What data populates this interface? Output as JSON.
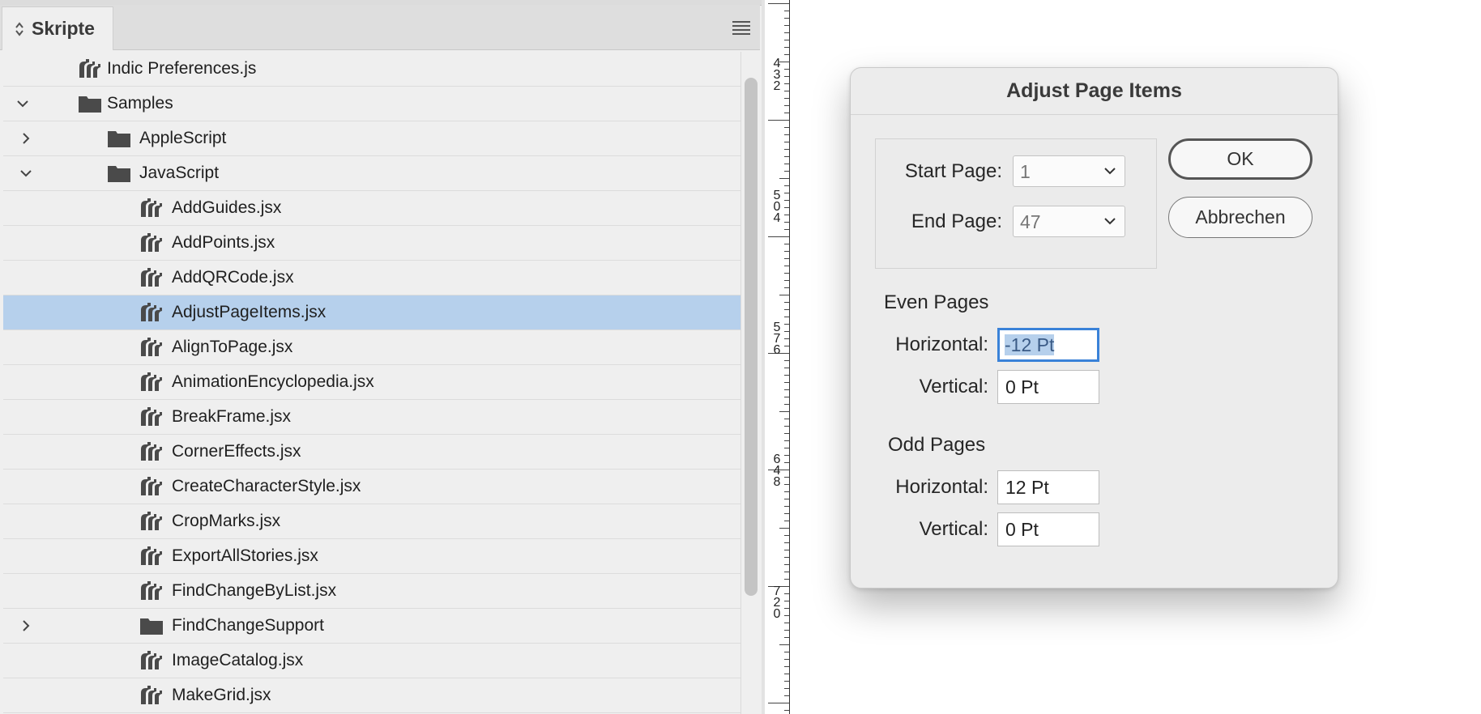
{
  "panel": {
    "tab_label": "Skripte",
    "items": [
      {
        "label": "Indic Preferences.js",
        "type": "script",
        "level": 2,
        "selected": false
      },
      {
        "label": "Samples",
        "type": "folder",
        "level": 2,
        "expanded": true,
        "selected": false
      },
      {
        "label": "AppleScript",
        "type": "folder",
        "level": 3,
        "expanded": false,
        "selected": false
      },
      {
        "label": "JavaScript",
        "type": "folder",
        "level": 3,
        "expanded": true,
        "selected": false
      },
      {
        "label": "AddGuides.jsx",
        "type": "script",
        "level": 4,
        "selected": false
      },
      {
        "label": "AddPoints.jsx",
        "type": "script",
        "level": 4,
        "selected": false
      },
      {
        "label": "AddQRCode.jsx",
        "type": "script",
        "level": 4,
        "selected": false
      },
      {
        "label": "AdjustPageItems.jsx",
        "type": "script",
        "level": 4,
        "selected": true
      },
      {
        "label": "AlignToPage.jsx",
        "type": "script",
        "level": 4,
        "selected": false
      },
      {
        "label": "AnimationEncyclopedia.jsx",
        "type": "script",
        "level": 4,
        "selected": false
      },
      {
        "label": "BreakFrame.jsx",
        "type": "script",
        "level": 4,
        "selected": false
      },
      {
        "label": "CornerEffects.jsx",
        "type": "script",
        "level": 4,
        "selected": false
      },
      {
        "label": "CreateCharacterStyle.jsx",
        "type": "script",
        "level": 4,
        "selected": false
      },
      {
        "label": "CropMarks.jsx",
        "type": "script",
        "level": 4,
        "selected": false
      },
      {
        "label": "ExportAllStories.jsx",
        "type": "script",
        "level": 4,
        "selected": false
      },
      {
        "label": "FindChangeByList.jsx",
        "type": "script",
        "level": 4,
        "selected": false
      },
      {
        "label": "FindChangeSupport",
        "type": "folder",
        "level": 4,
        "expanded": false,
        "selected": false
      },
      {
        "label": "ImageCatalog.jsx",
        "type": "script",
        "level": 4,
        "selected": false
      },
      {
        "label": "MakeGrid.jsx",
        "type": "script",
        "level": 4,
        "selected": false
      }
    ]
  },
  "ruler": {
    "labels": [
      "432",
      "504",
      "576",
      "648",
      "720"
    ]
  },
  "dialog": {
    "title": "Adjust Page Items",
    "start_page_label": "Start Page:",
    "start_page_value": "1",
    "end_page_label": "End Page:",
    "end_page_value": "47",
    "ok_label": "OK",
    "cancel_label": "Abbrechen",
    "even_pages": {
      "title": "Even Pages",
      "horizontal_label": "Horizontal:",
      "horizontal_value": "-12 Pt",
      "vertical_label": "Vertical:",
      "vertical_value": "0 Pt"
    },
    "odd_pages": {
      "title": "Odd Pages",
      "horizontal_label": "Horizontal:",
      "horizontal_value": "12 Pt",
      "vertical_label": "Vertical:",
      "vertical_value": "0 Pt"
    }
  },
  "colors": {
    "selection": "#b6d0ec",
    "focus_ring": "#3a82d8",
    "panel_bg": "#efefef",
    "dialog_bg": "#ececec"
  }
}
